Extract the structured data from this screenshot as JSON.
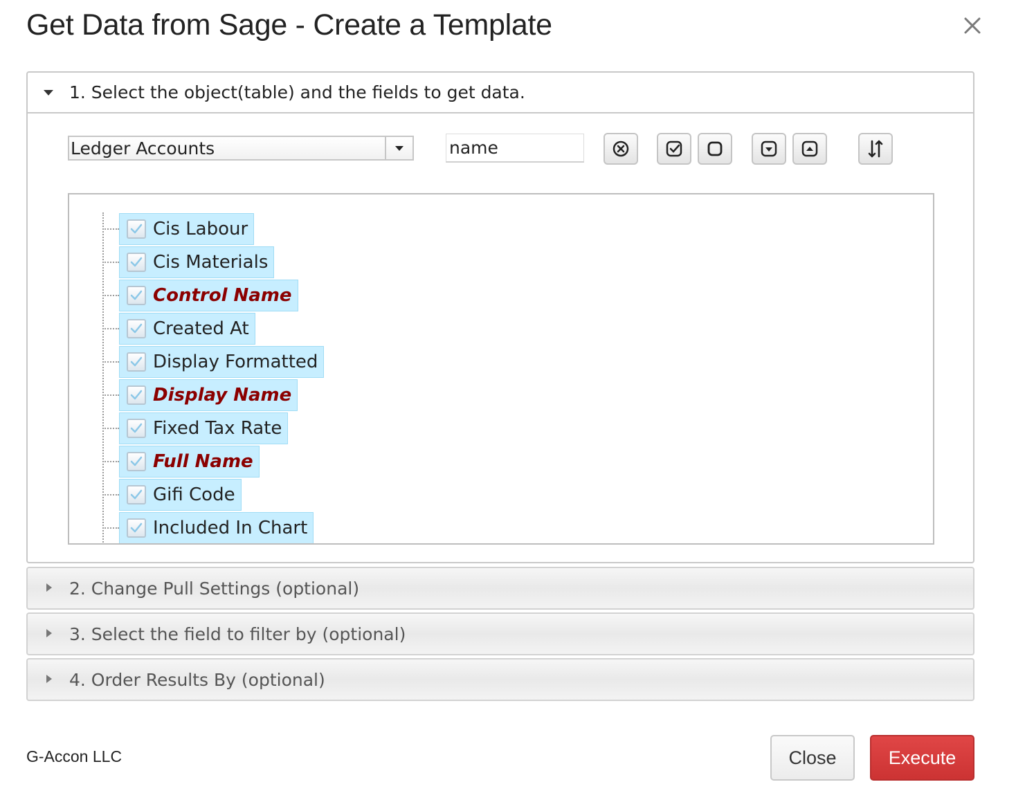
{
  "dialog": {
    "title": "Get Data from Sage - Create a Template"
  },
  "sections": [
    {
      "label": "1. Select the object(table) and the fields to get data.",
      "expanded": true
    },
    {
      "label": "2. Change Pull Settings (optional)",
      "expanded": false
    },
    {
      "label": "3. Select the field to filter by (optional)",
      "expanded": false
    },
    {
      "label": "4. Order Results By (optional)",
      "expanded": false
    }
  ],
  "object_select": {
    "value": "Ledger Accounts"
  },
  "search": {
    "value": "name"
  },
  "toolbar_icons": [
    "clear-icon",
    "check-all-icon",
    "uncheck-all-icon",
    "expand-down-icon",
    "collapse-up-icon",
    "sort-icon"
  ],
  "fields": [
    {
      "label": "Cis Labour",
      "checked": true,
      "key": false
    },
    {
      "label": "Cis Materials",
      "checked": true,
      "key": false
    },
    {
      "label": "Control Name",
      "checked": true,
      "key": true
    },
    {
      "label": "Created At",
      "checked": true,
      "key": false
    },
    {
      "label": "Display Formatted",
      "checked": true,
      "key": false
    },
    {
      "label": "Display Name",
      "checked": true,
      "key": true
    },
    {
      "label": "Fixed Tax Rate",
      "checked": true,
      "key": false
    },
    {
      "label": "Full Name",
      "checked": true,
      "key": true
    },
    {
      "label": "Gifi Code",
      "checked": true,
      "key": false
    },
    {
      "label": "Included In Chart",
      "checked": true,
      "key": false
    }
  ],
  "footer": {
    "company": "G-Accon LLC",
    "close_label": "Close",
    "execute_label": "Execute"
  },
  "colors": {
    "chip_bg": "#c7eeff",
    "key_field": "#8b0000",
    "execute": "#d63a3a"
  }
}
